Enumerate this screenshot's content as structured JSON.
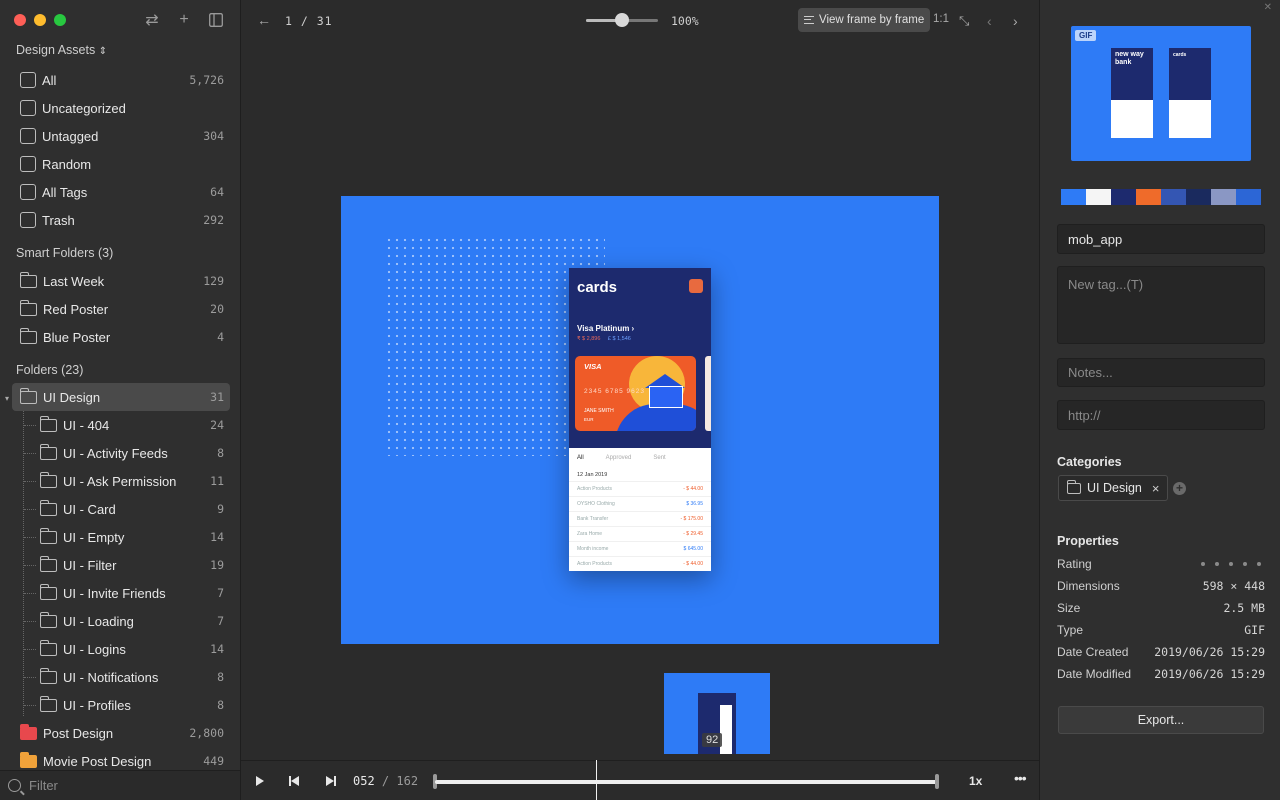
{
  "sidebar": {
    "library_title": "Design Assets",
    "library_chevron": "⌃⌄",
    "main_items": [
      {
        "label": "All",
        "count": "5,726"
      },
      {
        "label": "Uncategorized",
        "count": ""
      },
      {
        "label": "Untagged",
        "count": "304"
      },
      {
        "label": "Random",
        "count": ""
      },
      {
        "label": "All Tags",
        "count": "64"
      },
      {
        "label": "Trash",
        "count": "292"
      }
    ],
    "smart_title": "Smart Folders (3)",
    "smart_items": [
      {
        "label": "Last Week",
        "count": "129"
      },
      {
        "label": "Red Poster",
        "count": "20"
      },
      {
        "label": "Blue Poster",
        "count": "4"
      }
    ],
    "folders_title": "Folders (23)",
    "selected_folder": {
      "label": "UI Design",
      "count": "31"
    },
    "subfolders": [
      {
        "label": "UI - 404",
        "count": "24"
      },
      {
        "label": "UI - Activity Feeds",
        "count": "8"
      },
      {
        "label": "UI - Ask Permission",
        "count": "11"
      },
      {
        "label": "UI - Card",
        "count": "9"
      },
      {
        "label": "UI - Empty",
        "count": "14"
      },
      {
        "label": "UI - Filter",
        "count": "19"
      },
      {
        "label": "UI - Invite Friends",
        "count": "7"
      },
      {
        "label": "UI - Loading",
        "count": "7"
      },
      {
        "label": "UI - Logins",
        "count": "14"
      },
      {
        "label": "UI - Notifications",
        "count": "8"
      },
      {
        "label": "UI - Profiles",
        "count": "8"
      }
    ],
    "other_folders": [
      {
        "label": "Post Design",
        "count": "2,800",
        "color": "#e8484d"
      },
      {
        "label": "Movie Post Design",
        "count": "449",
        "color": "#f0a23a"
      }
    ],
    "filter_placeholder": "Filter"
  },
  "toolbar": {
    "page_indicator": "1 / 31",
    "zoom_level": "100%",
    "zoom_fraction": 0.5,
    "view_frame_label": "View frame by frame",
    "actual_size": "1:1"
  },
  "artwork": {
    "title": "cards",
    "card_name": "Visa Platinum",
    "amount_out": "₹ $ 2,896",
    "amount_in": "£ $ 1,546",
    "card_brand": "VISA",
    "card_number": "2345 6785 9623",
    "card_holder": "JANE SMITH",
    "card_exp": "EUR",
    "tabs": [
      "All",
      "Approved",
      "Sent"
    ],
    "list_date": "12 Jan 2019",
    "transactions": [
      {
        "name": "Action Products",
        "amount": "- $ 44.00",
        "sign": "neg"
      },
      {
        "name": "OYSHO Clothing",
        "amount": "$ 36.95",
        "sign": "pos"
      },
      {
        "name": "Bank Transfer",
        "amount": "- $ 175.00",
        "sign": "neg"
      },
      {
        "name": "Zara Home",
        "amount": "- $ 29.45",
        "sign": "neg"
      },
      {
        "name": "Month income",
        "amount": "$ 645.00",
        "sign": "pos"
      },
      {
        "name": "Action Products",
        "amount": "- $ 44.00",
        "sign": "neg"
      }
    ]
  },
  "thumbnail": {
    "badge": "92"
  },
  "player": {
    "current_frame": "052",
    "separator": "/",
    "total_frames": "162",
    "speed": "1x",
    "more": "•••",
    "progress": 0.32
  },
  "inspector": {
    "preview_badge": "GIF",
    "preview_text_left": "new way bank",
    "preview_text_right": "cards",
    "palette": [
      "#2e7bf6",
      "#f5f5f5",
      "#1d2a6e",
      "#ef6b2a",
      "#3456b3",
      "#1a2a5e",
      "#8a97c4",
      "#2c66d6"
    ],
    "name_value": "mob_app",
    "tags_placeholder": "New tag...(T)",
    "notes_placeholder": "Notes...",
    "url_placeholder": "http://",
    "categories_title": "Categories",
    "category_chip": "UI Design",
    "category_remove": "×",
    "properties_title": "Properties",
    "properties": [
      {
        "key": "Rating",
        "value": ""
      },
      {
        "key": "Dimensions",
        "value": "598 × 448"
      },
      {
        "key": "Size",
        "value": "2.5 MB"
      },
      {
        "key": "Type",
        "value": "GIF"
      },
      {
        "key": "Date Created",
        "value": "2019/06/26 15:29"
      },
      {
        "key": "Date Modified",
        "value": "2019/06/26 15:29"
      }
    ],
    "export_label": "Export..."
  }
}
